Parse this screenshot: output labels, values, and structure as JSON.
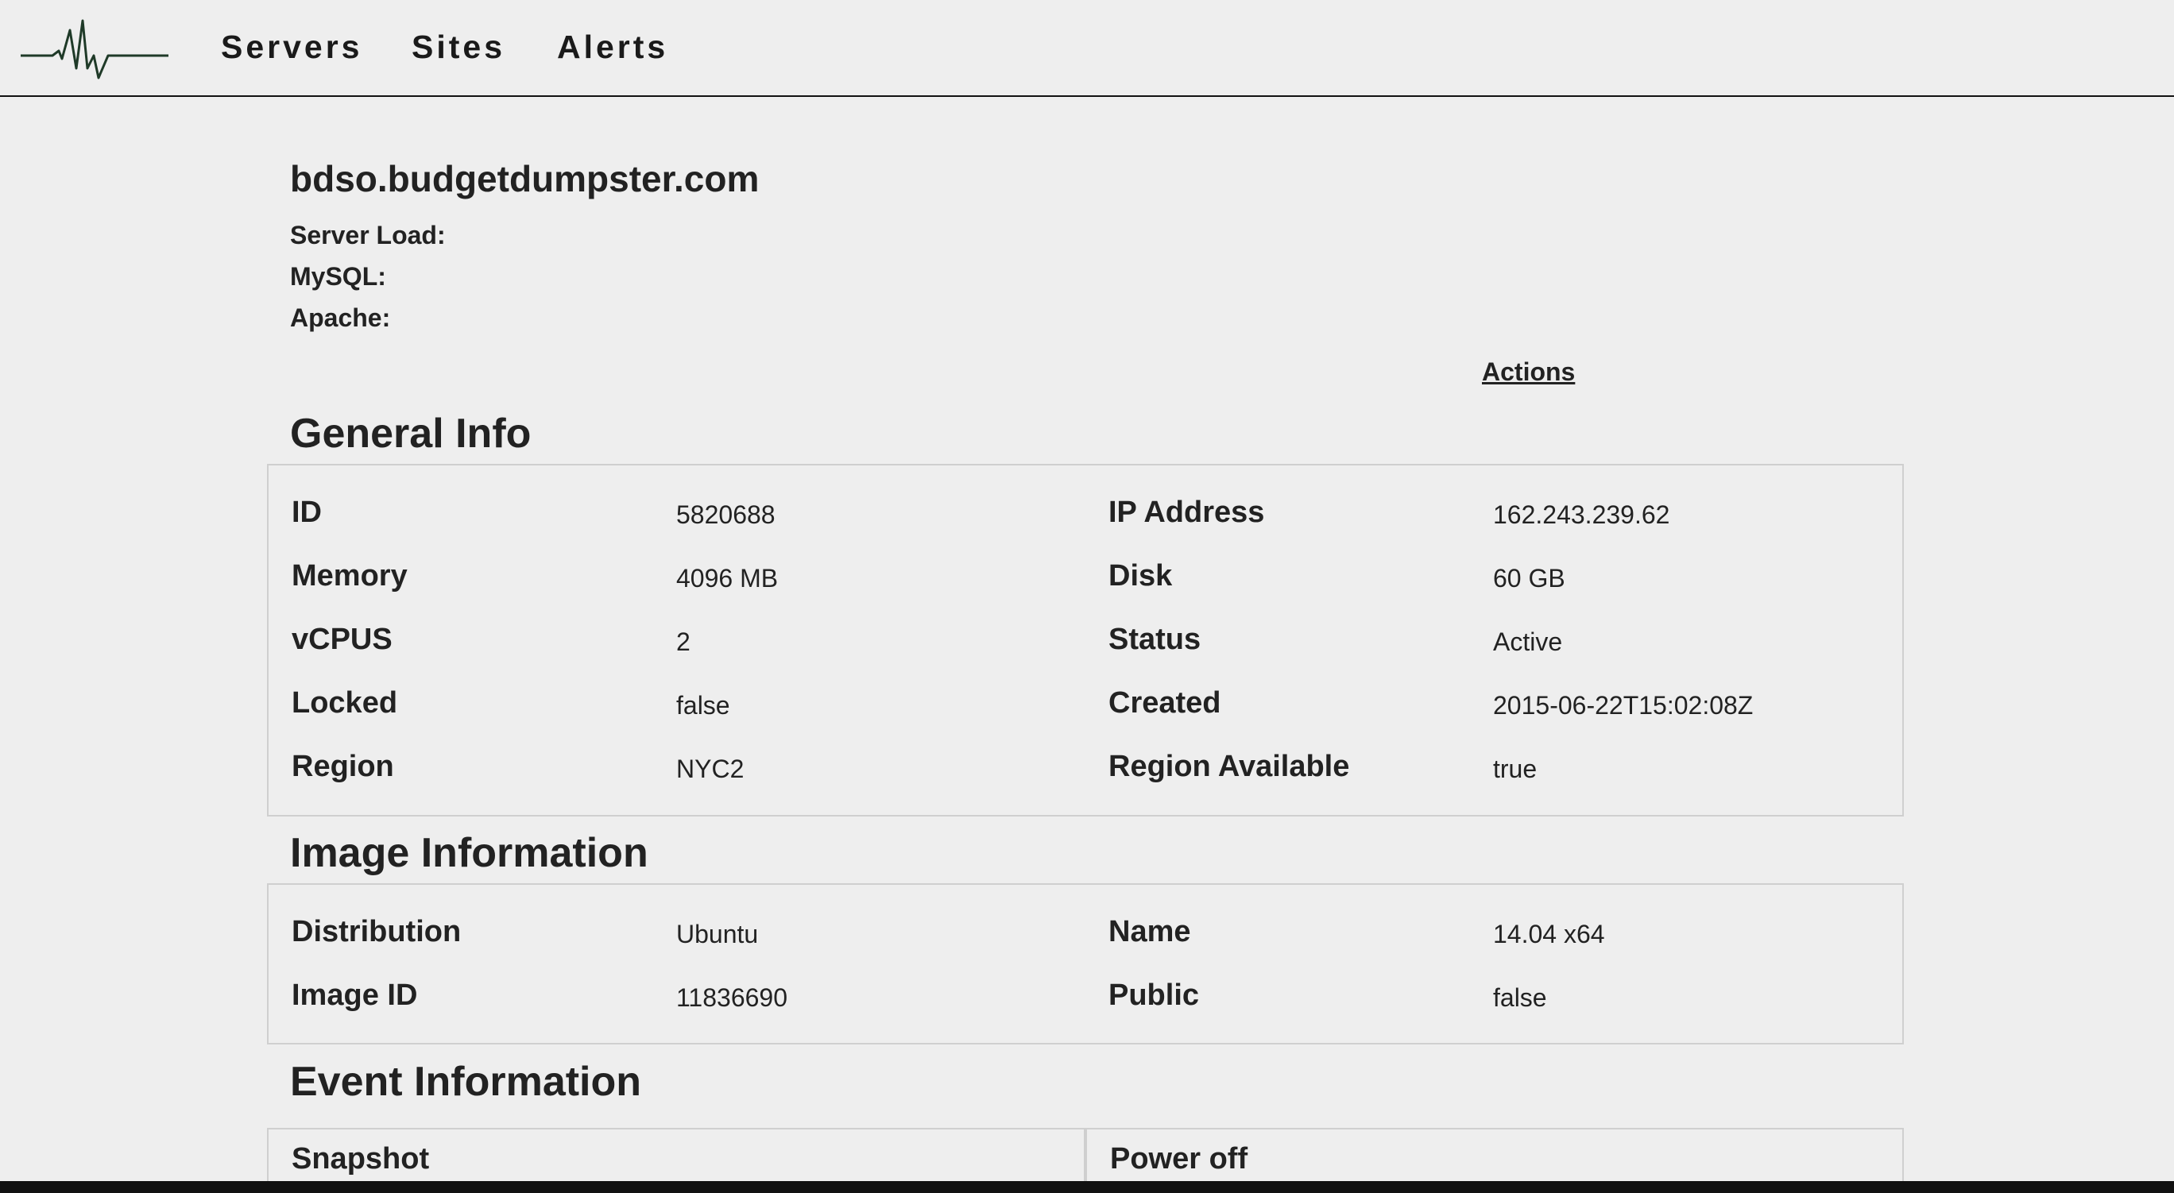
{
  "nav": {
    "logo_icon": "heartbeat-pulse-icon",
    "items": [
      "Servers",
      "Sites",
      "Alerts"
    ]
  },
  "server": {
    "hostname": "bdso.budgetdumpster.com",
    "stats": {
      "server_load_label": "Server Load:",
      "mysql_label": "MySQL:",
      "apache_label": "Apache:"
    },
    "actions_label": "Actions"
  },
  "general_info": {
    "title": "General Info",
    "rows": [
      {
        "label_left": "ID",
        "value_left": "5820688",
        "label_right": "IP Address",
        "value_right": "162.243.239.62"
      },
      {
        "label_left": "Memory",
        "value_left": "4096 MB",
        "label_right": "Disk",
        "value_right": "60 GB"
      },
      {
        "label_left": "vCPUS",
        "value_left": "2",
        "label_right": "Status",
        "value_right": "Active"
      },
      {
        "label_left": "Locked",
        "value_left": "false",
        "label_right": "Created",
        "value_right": "2015-06-22T15:02:08Z"
      },
      {
        "label_left": "Region",
        "value_left": "NYC2",
        "label_right": "Region Available",
        "value_right": "true"
      }
    ]
  },
  "image_info": {
    "title": "Image Information",
    "rows": [
      {
        "label_left": "Distribution",
        "value_left": "Ubuntu",
        "label_right": "Name",
        "value_right": "14.04 x64"
      },
      {
        "label_left": "Image ID",
        "value_left": "11836690",
        "label_right": "Public",
        "value_right": "false"
      }
    ]
  },
  "event_info": {
    "title": "Event Information",
    "events": [
      "Snapshot",
      "Power off"
    ]
  },
  "colors": {
    "background": "#eeeeee",
    "text": "#222222",
    "border": "#cfcfcf",
    "logo_line": "#1f3a28"
  }
}
